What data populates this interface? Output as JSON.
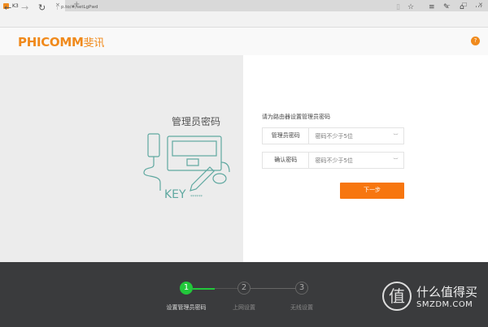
{
  "browser": {
    "tab_title": "K3",
    "url": "p.to/#/setLgPwd",
    "new_tab": "+",
    "close": "×",
    "min": "–",
    "max": "☐",
    "close_win": "✕"
  },
  "header": {
    "logo_text": "PHICOMM",
    "logo_cn": "斐讯",
    "help": "?"
  },
  "illustration": {
    "title": "管理员密码",
    "key_text": "KEY",
    "key_dots": "******"
  },
  "form": {
    "prompt": "请为路由器设置管理员密码",
    "fields": [
      {
        "label": "管理员密码",
        "placeholder": "密码不少于5位"
      },
      {
        "label": "确认密码",
        "placeholder": "密码不少于5位"
      }
    ],
    "next_label": "下一步"
  },
  "steps": [
    {
      "num": "1",
      "label": "设置管理员密码",
      "active": true
    },
    {
      "num": "2",
      "label": "上网设置",
      "active": false
    },
    {
      "num": "3",
      "label": "无线设置",
      "active": false
    }
  ],
  "watermark": {
    "seal": "值",
    "line1": "什么值得买",
    "line2": "SMZDM.COM"
  },
  "colors": {
    "accent": "#f08a1c",
    "button": "#f7760f",
    "step_active": "#22c73b",
    "footer": "#3a3b3d"
  }
}
